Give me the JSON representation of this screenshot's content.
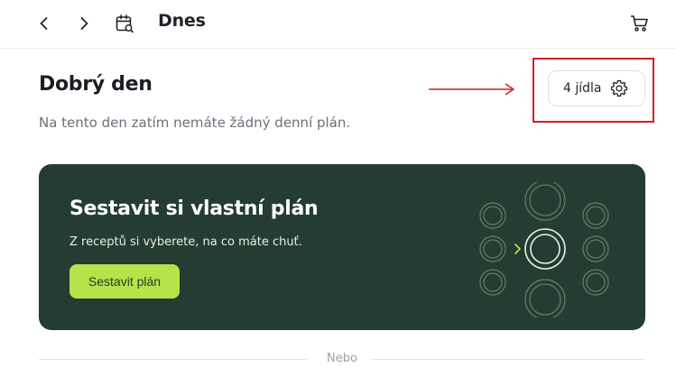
{
  "header": {
    "title": "Dnes",
    "back_icon": "chevron-left-icon",
    "forward_icon": "chevron-right-icon",
    "calendar_icon": "calendar-search-icon",
    "cart_icon": "cart-icon"
  },
  "main": {
    "greeting": "Dobrý den",
    "empty_message": "Na tento den zatím nemáte žádný denní plán.",
    "meals_button": {
      "label": "4 jídla",
      "icon": "gear-icon"
    }
  },
  "card": {
    "title": "Sestavit si vlastní plán",
    "text": "Z receptů si vyberete, na co máte chuť.",
    "button_label": "Sestavit plán",
    "background_color": "#243c31",
    "accent_color": "#b7e24a"
  },
  "divider": {
    "label": "Nebo"
  },
  "annotation": {
    "color": "#d21f26"
  }
}
